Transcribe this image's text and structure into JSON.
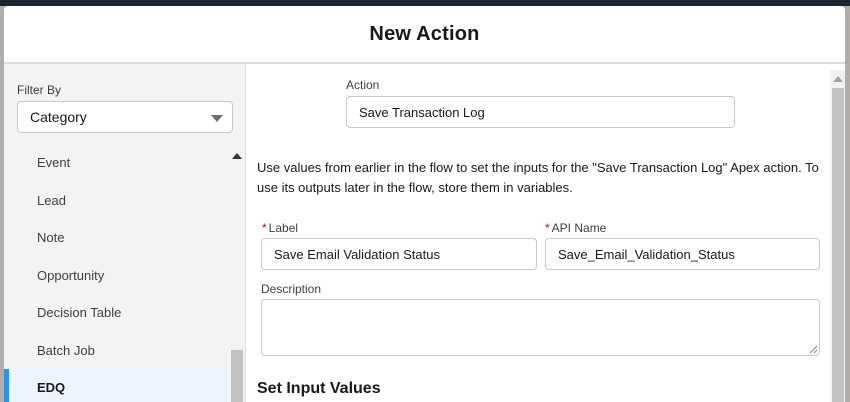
{
  "modal": {
    "title": "New Action"
  },
  "sidebar": {
    "filter_label": "Filter By",
    "filter_value": "Category",
    "items": [
      {
        "label": "Event"
      },
      {
        "label": "Lead"
      },
      {
        "label": "Note"
      },
      {
        "label": "Opportunity"
      },
      {
        "label": "Decision Table"
      },
      {
        "label": "Batch Job"
      },
      {
        "label": "EDQ"
      }
    ],
    "selected": "EDQ"
  },
  "form": {
    "action_label": "Action",
    "action_value": "Save Transaction Log",
    "help_text": "Use values from earlier in the flow to set the inputs for the \"Save Transaction Log\" Apex action. To use its outputs later in the flow, store them in variables.",
    "required_marker": "*",
    "label_label": "Label",
    "label_value": "Save Email Validation Status",
    "api_name_label": "API Name",
    "api_name_value": "Save_Email_Validation_Status",
    "description_label": "Description",
    "description_value": "",
    "set_input_values_heading": "Set Input Values"
  },
  "colors": {
    "accent": "#1b96ff",
    "required": "#ba0517",
    "selected_bg": "#eef4ff"
  }
}
